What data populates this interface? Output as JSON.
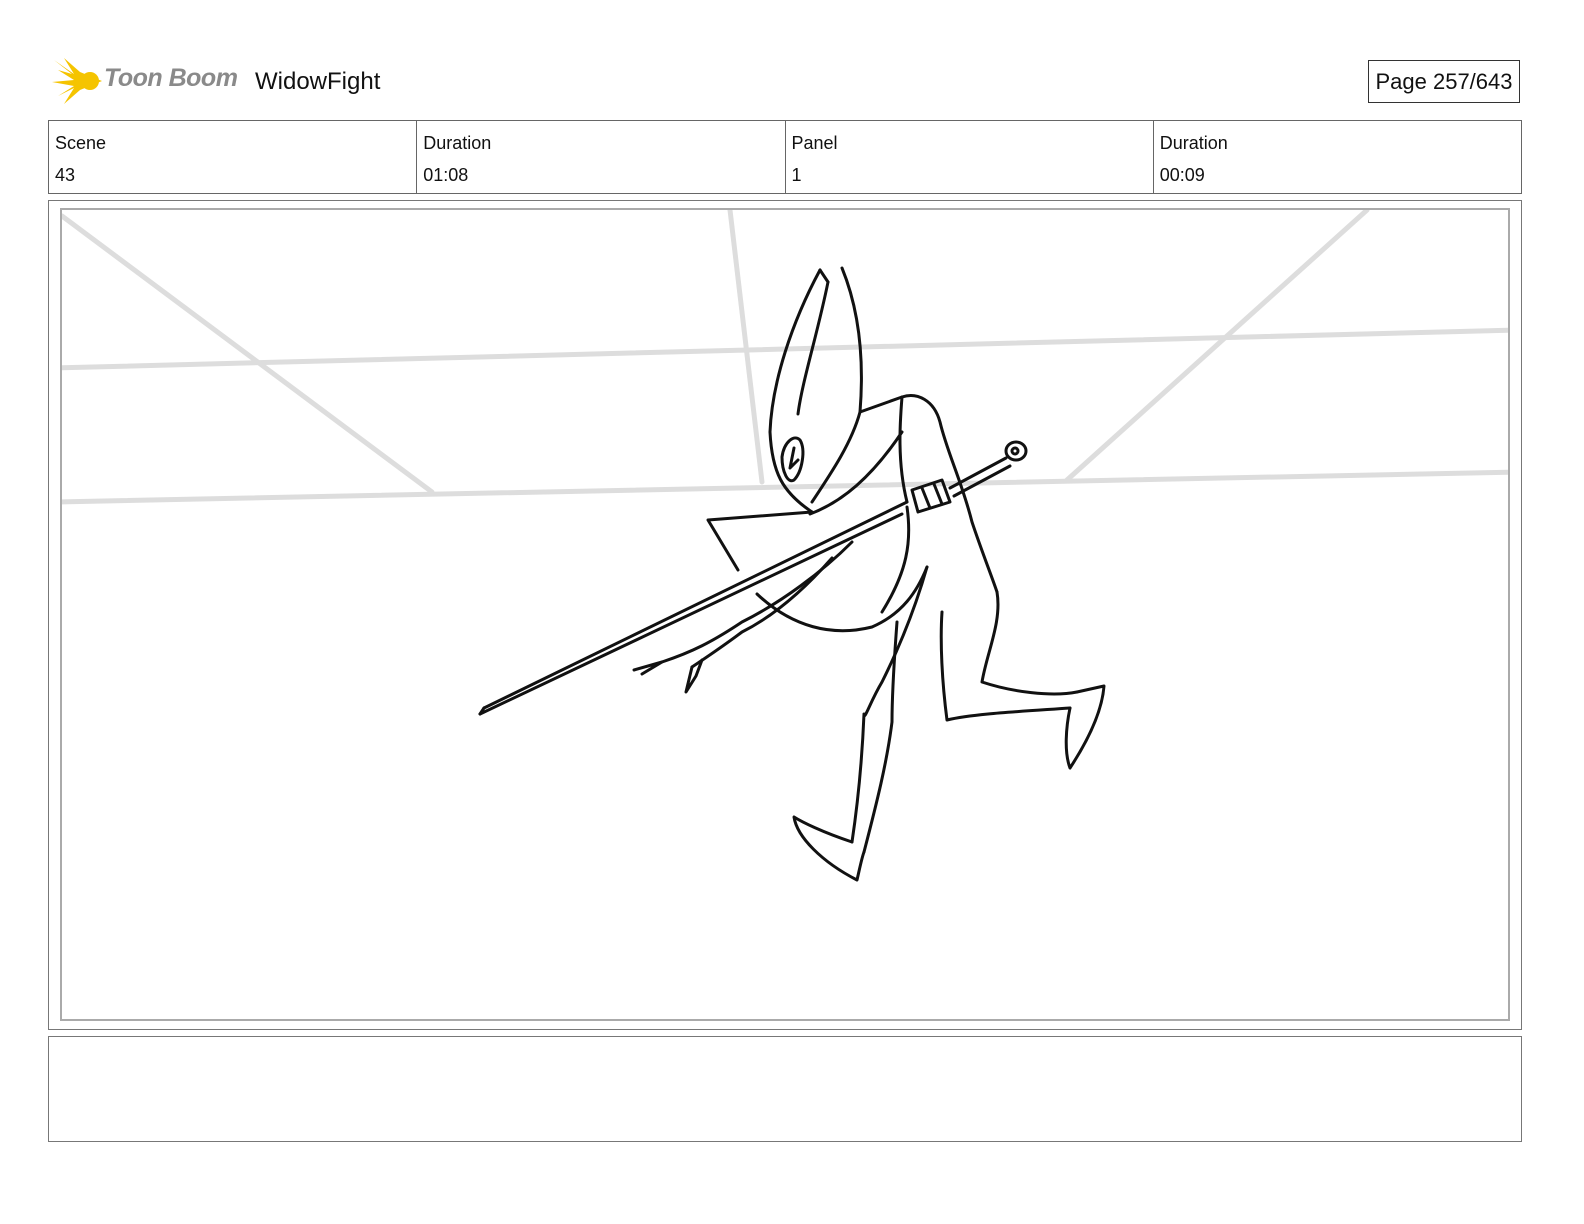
{
  "header": {
    "logo_text": "Toon Boom",
    "project_title": "WidowFight",
    "page_label": "Page 257/643"
  },
  "info": [
    {
      "label": "Scene",
      "value": "43"
    },
    {
      "label": "Duration",
      "value": "01:08"
    },
    {
      "label": "Panel",
      "value": "1"
    },
    {
      "label": "Duration",
      "value": "00:09"
    }
  ],
  "colors": {
    "logo_accent": "#f5c400",
    "sketch_line": "#111111",
    "guide_line": "#dddddd"
  },
  "notes": ""
}
